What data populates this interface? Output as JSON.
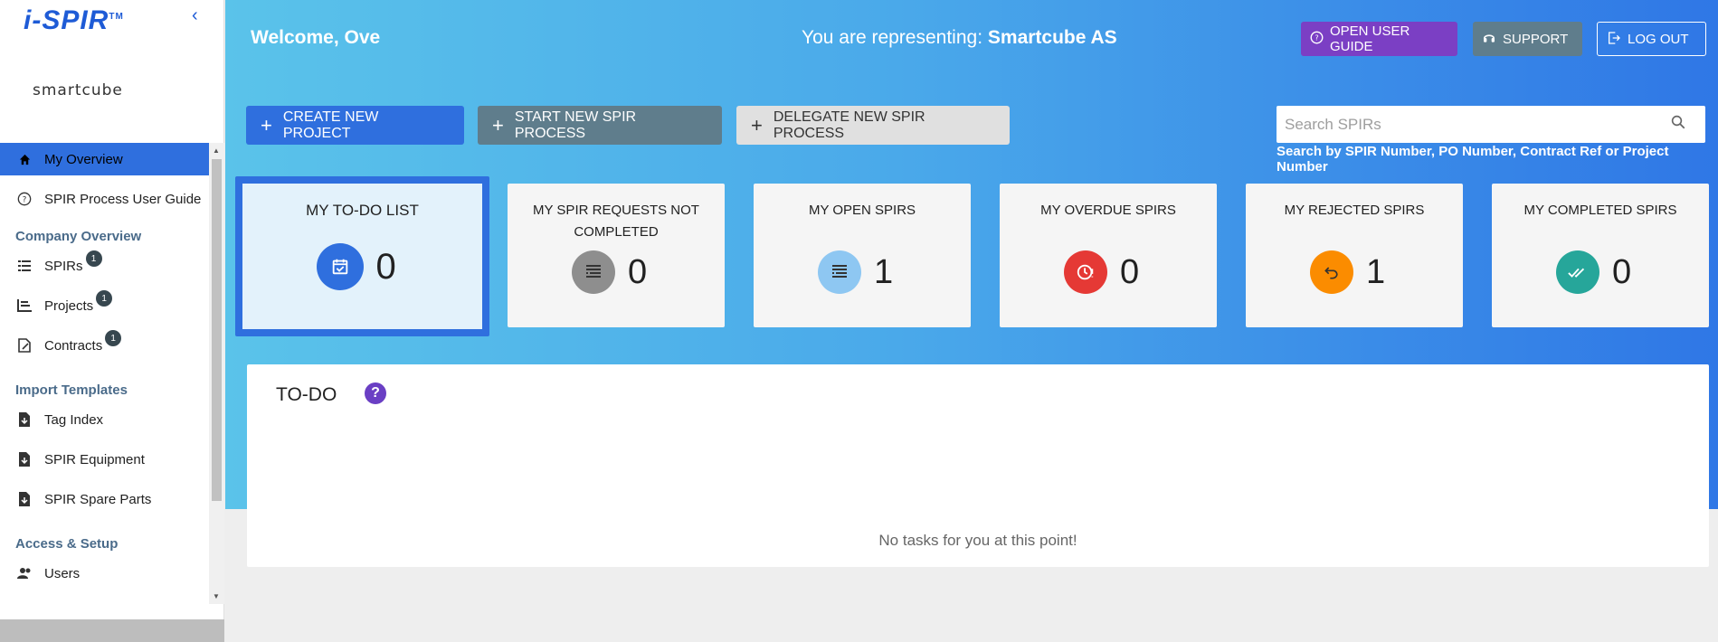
{
  "app": {
    "brand": "i-SPIR",
    "brand_tm": "TM",
    "company_logo": "smartcube"
  },
  "sidebar": {
    "items": [
      {
        "label": "My Overview",
        "icon": "home-icon",
        "active": true
      },
      {
        "label": "SPIR Process User Guide",
        "icon": "help-circle-icon"
      }
    ],
    "sections": [
      {
        "title": "Company Overview",
        "items": [
          {
            "label": "SPIRs",
            "icon": "list-icon",
            "badge": "1"
          },
          {
            "label": "Projects",
            "icon": "projects-icon",
            "badge": "1"
          },
          {
            "label": "Contracts",
            "icon": "contract-icon",
            "badge": "1"
          }
        ]
      },
      {
        "title": "Import Templates",
        "items": [
          {
            "label": "Tag Index",
            "icon": "file-download-icon"
          },
          {
            "label": "SPIR Equipment",
            "icon": "file-download-icon"
          },
          {
            "label": "SPIR Spare Parts",
            "icon": "file-download-icon"
          }
        ]
      },
      {
        "title": "Access & Setup",
        "items": [
          {
            "label": "Users",
            "icon": "users-icon"
          }
        ]
      }
    ]
  },
  "header": {
    "welcome": "Welcome, Ove",
    "representing_label": "You are representing:",
    "representing_company": "Smartcube AS",
    "guide_button": "OPEN USER GUIDE",
    "support_button": "SUPPORT",
    "logout_button": "LOG OUT"
  },
  "actions": {
    "create_project": "CREATE NEW PROJECT",
    "start_spir": "START NEW SPIR PROCESS",
    "delegate_spir": "DELEGATE NEW SPIR PROCESS"
  },
  "search": {
    "placeholder": "Search SPIRs",
    "hint": "Search by SPIR Number, PO Number, Contract Ref or Project Number"
  },
  "cards": [
    {
      "title": "MY TO-DO LIST",
      "count": "0",
      "color": "#2f6fde",
      "icon": "calendar-check-icon"
    },
    {
      "title": "MY SPIR REQUESTS NOT COMPLETED",
      "count": "0",
      "color": "#8e8e8e",
      "icon": "document-list-icon"
    },
    {
      "title": "MY OPEN SPIRS",
      "count": "1",
      "color": "#8ec7f2",
      "icon": "document-list-icon"
    },
    {
      "title": "MY OVERDUE SPIRS",
      "count": "0",
      "color": "#e53935",
      "icon": "overdue-clock-icon"
    },
    {
      "title": "MY REJECTED SPIRS",
      "count": "1",
      "color": "#fb8c00",
      "icon": "undo-icon"
    },
    {
      "title": "MY COMPLETED SPIRS",
      "count": "0",
      "color": "#26a69a",
      "icon": "double-check-icon"
    }
  ],
  "todo": {
    "title": "TO-DO",
    "empty_message": "No tasks for you at this point!"
  }
}
